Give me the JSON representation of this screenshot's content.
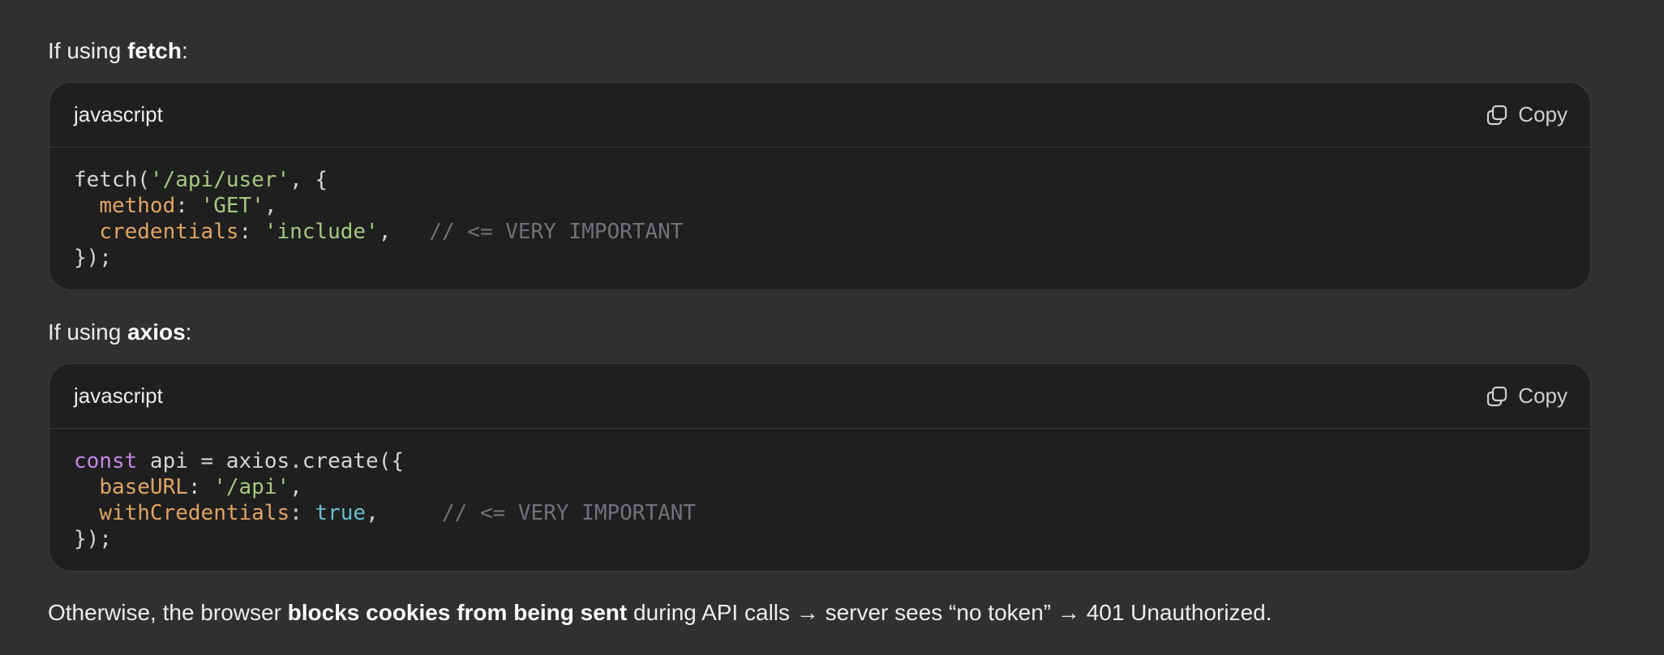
{
  "section1": {
    "intro_prefix": "If using ",
    "intro_bold": "fetch",
    "intro_suffix": ":",
    "code_block": {
      "language": "javascript",
      "copy_label": "Copy",
      "lines": [
        [
          {
            "t": "fetch(",
            "c": "pl"
          },
          {
            "t": "'/api/user'",
            "c": "str"
          },
          {
            "t": ", {",
            "c": "pl"
          }
        ],
        [
          {
            "t": "  ",
            "c": "pl"
          },
          {
            "t": "method",
            "c": "prop"
          },
          {
            "t": ": ",
            "c": "pl"
          },
          {
            "t": "'GET'",
            "c": "str"
          },
          {
            "t": ",",
            "c": "pl"
          }
        ],
        [
          {
            "t": "  ",
            "c": "pl"
          },
          {
            "t": "credentials",
            "c": "prop"
          },
          {
            "t": ": ",
            "c": "pl"
          },
          {
            "t": "'include'",
            "c": "str"
          },
          {
            "t": ",   ",
            "c": "pl"
          },
          {
            "t": "// <= VERY IMPORTANT",
            "c": "cm"
          }
        ],
        [
          {
            "t": "});",
            "c": "pl"
          }
        ]
      ]
    }
  },
  "section2": {
    "intro_prefix": "If using ",
    "intro_bold": "axios",
    "intro_suffix": ":",
    "code_block": {
      "language": "javascript",
      "copy_label": "Copy",
      "lines": [
        [
          {
            "t": "const",
            "c": "kw"
          },
          {
            "t": " api = axios.create({",
            "c": "pl"
          }
        ],
        [
          {
            "t": "  ",
            "c": "pl"
          },
          {
            "t": "baseURL",
            "c": "prop"
          },
          {
            "t": ": ",
            "c": "pl"
          },
          {
            "t": "'/api'",
            "c": "str"
          },
          {
            "t": ",",
            "c": "pl"
          }
        ],
        [
          {
            "t": "  ",
            "c": "pl"
          },
          {
            "t": "withCredentials",
            "c": "prop"
          },
          {
            "t": ": ",
            "c": "pl"
          },
          {
            "t": "true",
            "c": "bool"
          },
          {
            "t": ",     ",
            "c": "pl"
          },
          {
            "t": "// <= VERY IMPORTANT",
            "c": "cm"
          }
        ],
        [
          {
            "t": "});",
            "c": "pl"
          }
        ]
      ]
    }
  },
  "conclusion": {
    "prefix": "Otherwise, the browser ",
    "bold": "blocks cookies from being sent",
    "suffix": " during API calls → server sees “no token” → 401 Unauthorized."
  },
  "colors": {
    "background": "#303030",
    "code_background": "#1f1f1f",
    "string": "#a5c880",
    "property": "#e0a463",
    "keyword": "#c586e4",
    "boolean": "#6cbcd1",
    "comment": "#6f7278"
  },
  "icons": {
    "copy": "copy-icon"
  }
}
